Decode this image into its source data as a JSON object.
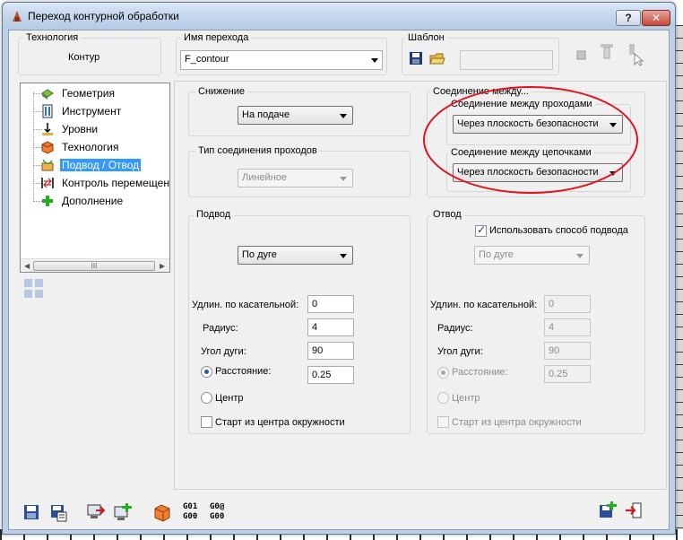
{
  "window": {
    "title": "Переход контурной обработки",
    "help_label": "?",
    "close_label": "✕"
  },
  "technology_box": {
    "legend": "Технология",
    "value": "Контур"
  },
  "name_box": {
    "legend": "Имя перехода",
    "value": "F_contour"
  },
  "template_box": {
    "legend": "Шаблон",
    "value": ""
  },
  "tree": {
    "items": [
      {
        "label": "Геометрия",
        "icon": "geometry-icon"
      },
      {
        "label": "Инструмент",
        "icon": "tool-icon"
      },
      {
        "label": "Уровни",
        "icon": "levels-icon"
      },
      {
        "label": "Технология",
        "icon": "technology-icon"
      },
      {
        "label": "Подвод / Отвод",
        "icon": "approach-retract-icon",
        "selected": true
      },
      {
        "label": "Контроль перемещен",
        "icon": "motion-control-icon"
      },
      {
        "label": "Дополнение",
        "icon": "add-icon"
      }
    ],
    "scroll_thumb": "III"
  },
  "descent": {
    "legend": "Снижение",
    "value": "На подаче"
  },
  "pass_link_type": {
    "legend": "Тип соединения проходов",
    "value": "Линейное"
  },
  "connection": {
    "legend": "Соединение между...",
    "between_passes": {
      "label": "Соединение между проходами",
      "value": "Через плоскость безопасности"
    },
    "between_chains": {
      "label": "Соединение между цепочками",
      "value": "Через плоскость безопасности"
    }
  },
  "approach": {
    "legend": "Подвод",
    "type": "По дуге",
    "tangent_ext_label": "Удлин. по касательной:",
    "tangent_ext": "0",
    "radius_label": "Радиус:",
    "radius": "4",
    "arc_angle_label": "Угол дуги:",
    "arc_angle": "90",
    "distance_label": "Расстояние:",
    "distance": "0.25",
    "center_label": "Центр",
    "start_center_label": "Старт из центра окружности"
  },
  "retract": {
    "legend": "Отвод",
    "use_approach_label": "Использовать способ подвода",
    "type": "По дуге",
    "tangent_ext_label": "Удлин. по касательной:",
    "tangent_ext": "0",
    "radius_label": "Радиус:",
    "radius": "4",
    "arc_angle_label": "Угол дуги:",
    "arc_angle": "90",
    "distance_label": "Расстояние:",
    "distance": "0.25",
    "center_label": "Центр",
    "start_center_label": "Старт из центра окружности"
  },
  "bottom_toolbar": {
    "gcode1": [
      "G01",
      "G00"
    ],
    "gcode2": [
      "G0@",
      "G00"
    ]
  },
  "colors": {
    "accent": "#3399ff",
    "annotation": "#e2121b",
    "window_frame": "#bcd0e6"
  }
}
